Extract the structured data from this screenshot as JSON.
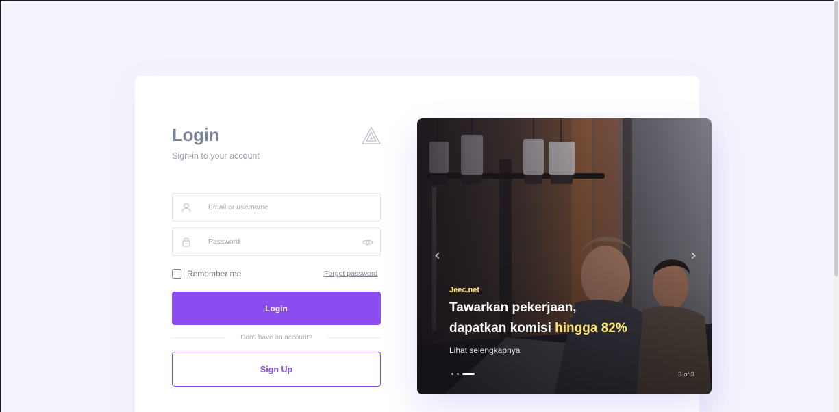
{
  "login": {
    "title": "Login",
    "subtitle": "Sign-in to your account",
    "logo_icon": "triangle-logo-icon",
    "email_placeholder": "Email or username",
    "password_placeholder": "Password",
    "remember_label": "Remember me",
    "remember_checked": false,
    "forgot_label": "Forgot password",
    "login_button": "Login",
    "divider_text": "Don't have an account?",
    "signup_button": "Sign Up"
  },
  "carousel": {
    "brand": "Jeec.net",
    "headline_part1": "Tawarkan pekerjaan,",
    "headline_part2": "dapatkan komisi",
    "headline_highlight": "hingga 82%",
    "link_text": "Lihat selengkapnya",
    "counter": "3 of 3",
    "active_slide": 3,
    "slide_count": 3,
    "prev_icon": "chevron-left-icon",
    "next_icon": "chevron-right-icon"
  },
  "colors": {
    "accent": "#8b4cf0",
    "highlight": "#ffe66b",
    "page_background": "#f4f3fc"
  }
}
